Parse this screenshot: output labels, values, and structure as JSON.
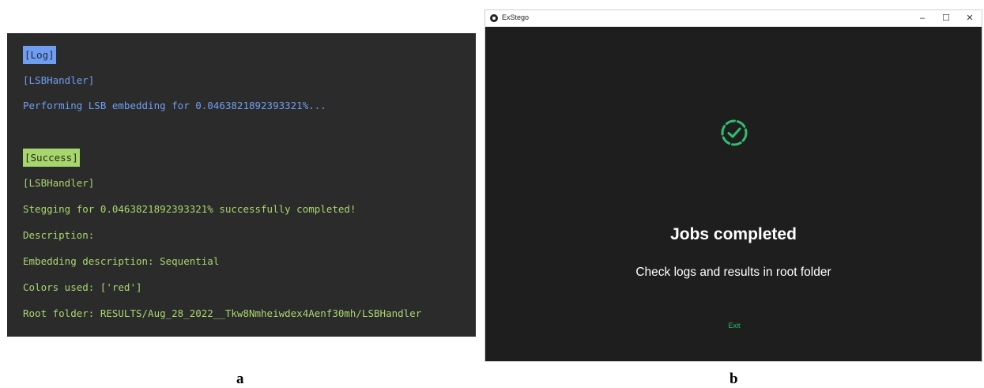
{
  "panel_a": {
    "lines": [
      {
        "text": "[Log]"
      },
      {
        "text": "[LSBHandler]"
      },
      {
        "text": "Performing LSB embedding for 0.0463821892393321%..."
      },
      {
        "text": "[Success]"
      },
      {
        "text": "[LSBHandler]"
      },
      {
        "text": "Stegging for 0.0463821892393321% successfully completed!"
      },
      {
        "text": "Description:"
      },
      {
        "text": "Embedding description: Sequential"
      },
      {
        "text": "Colors used: ['red']"
      },
      {
        "text": "Root folder: RESULTS/Aug_28_2022__Tkw8Nmheiwdex4Aenf30mh/LSBHandler"
      }
    ],
    "caption": "a"
  },
  "panel_b": {
    "window_title": "ExStego",
    "app_icon": "app-logo-icon",
    "controls": {
      "minimize": "–",
      "maximize": "☐",
      "close": "✕"
    },
    "status_icon": "check-circle-icon",
    "heading": "Jobs completed",
    "message": "Check logs and results in root folder",
    "exit_label": "Exit",
    "caption": "b"
  },
  "colors": {
    "terminal_bg": "#2b2b2b",
    "log_blue": "#6f9ef0",
    "success_green": "#a8d66e",
    "window_bg": "#1e1e1e",
    "accent_green": "#2fbf71"
  }
}
